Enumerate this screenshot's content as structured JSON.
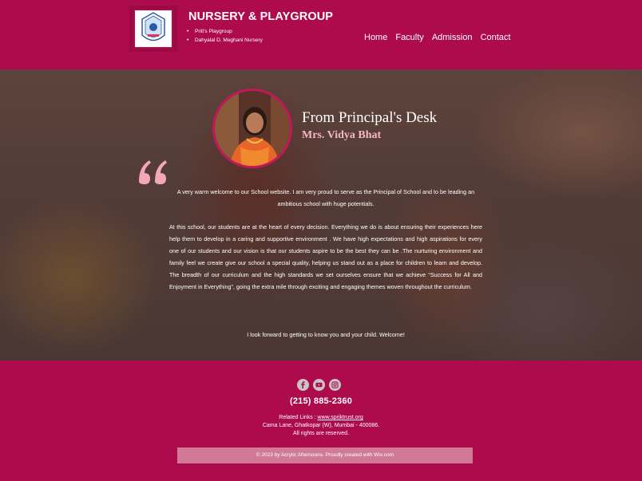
{
  "header": {
    "title": "NURSERY & PLAYGROUP",
    "sub_items": [
      "Priti's Playgroup",
      "Dahyalal D. Meghani Nursery"
    ],
    "nav": [
      "Home",
      "Faculty",
      "Admission",
      "Contact"
    ]
  },
  "hero": {
    "heading": "From Principal's Desk",
    "principal": "Mrs. Vidya Bhat",
    "intro": "A very warm welcome to our School website. I am very proud to serve as the Principal of School and to be leading an ambitious school with huge potentials.",
    "body": "At this school, our students are at the heart of every decision. Everything we do is about ensuring their experiences here help them to develop in a caring and supportive environment . We have high expectations and high aspirations for every one of our students and our vision is that our students aspire to be the best they can be .The nurturing environment and family feel we create give our school a special quality, helping us stand out as a place for children to learn and develop. The breadth of our curriculum and the high standards we set ourselves ensure that we achieve “Success for All and Enjoyment in Everything”, going the extra mile through exciting and engaging themes woven throughout the curriculum.",
    "closing": "I look forward to getting to know you and your child. Welcome!"
  },
  "footer": {
    "phone": "(215) 885-2360",
    "related_label": "Related Links : ",
    "related_link": "www.sprjktrust.org",
    "address": "Cama Lane, Ghatkopar (W), Mumbai - 400086.",
    "rights": "All rights are reserved.",
    "copyright": "© 2023 by Acrylic Afternoons. Proudly created with Wix.com"
  },
  "icons": {
    "social": [
      "facebook-icon",
      "youtube-icon",
      "instagram-icon"
    ]
  },
  "colors": {
    "brand": "#ad0b4c",
    "accent_pink": "#f6b7c7",
    "quote": "#f4a7b9"
  }
}
